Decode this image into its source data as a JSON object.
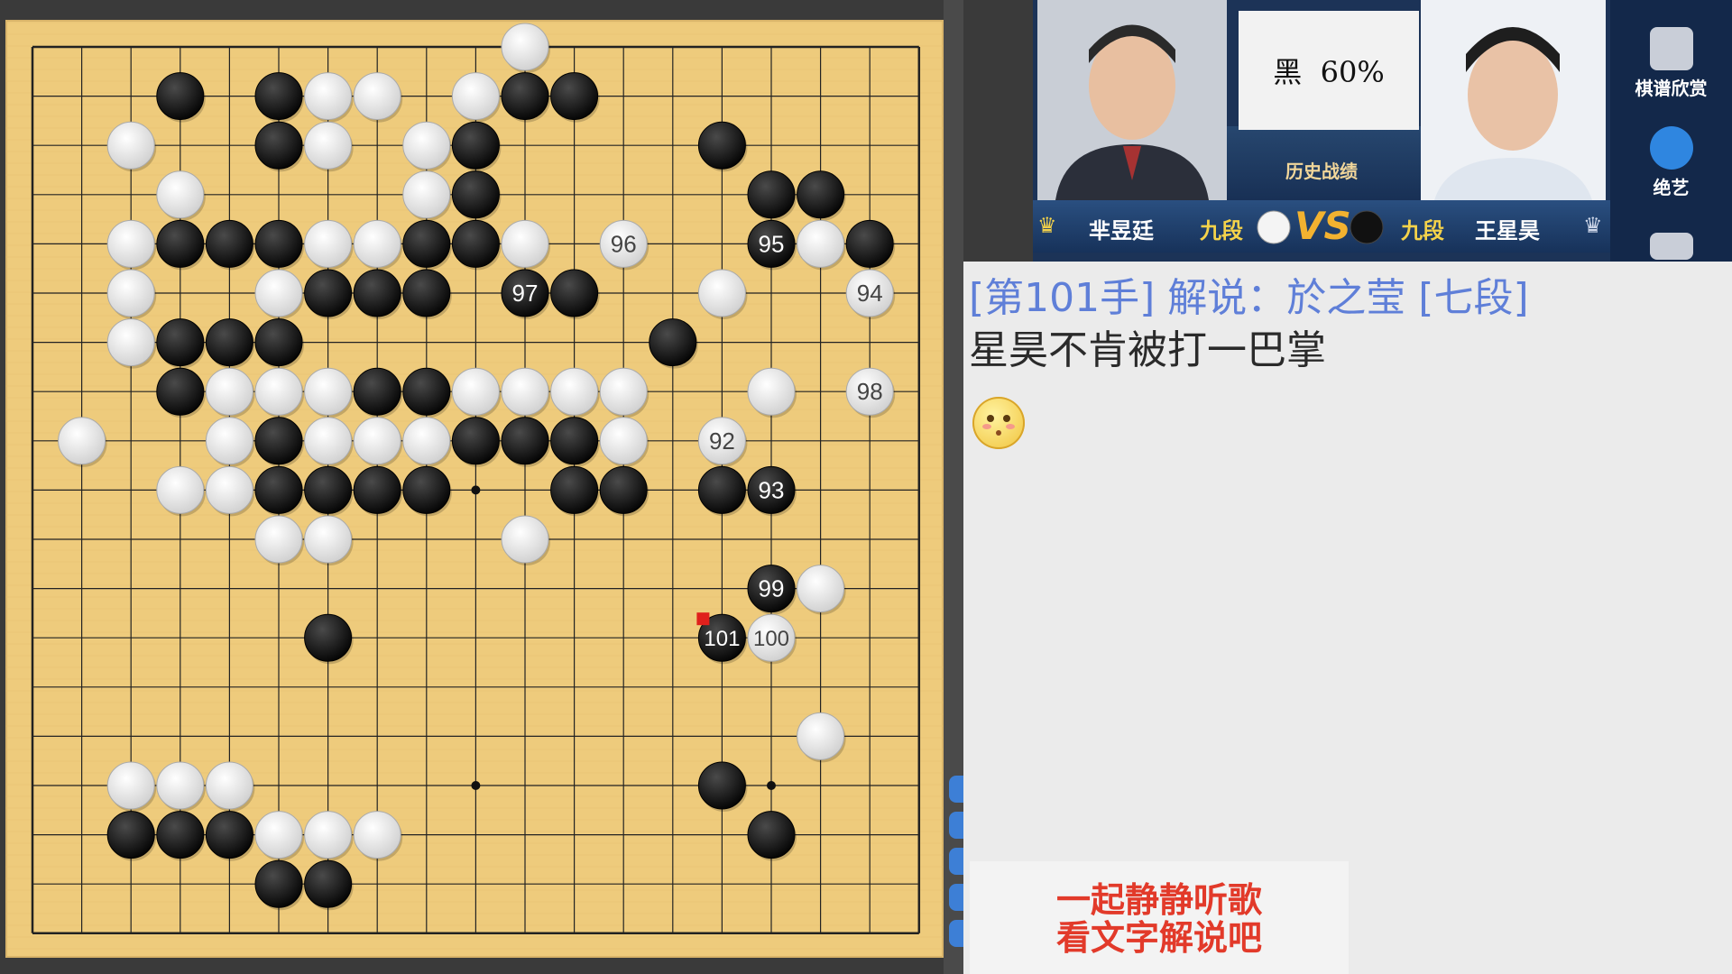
{
  "board": {
    "size": 19,
    "star_points": [
      [
        3,
        3
      ],
      [
        3,
        9
      ],
      [
        3,
        15
      ],
      [
        9,
        3
      ],
      [
        9,
        9
      ],
      [
        9,
        15
      ],
      [
        15,
        3
      ],
      [
        15,
        9
      ],
      [
        15,
        15
      ]
    ],
    "stones": [
      {
        "c": "w",
        "x": 10,
        "y": 0
      },
      {
        "c": "b",
        "x": 3,
        "y": 1
      },
      {
        "c": "b",
        "x": 5,
        "y": 1
      },
      {
        "c": "w",
        "x": 6,
        "y": 1
      },
      {
        "c": "w",
        "x": 7,
        "y": 1
      },
      {
        "c": "w",
        "x": 9,
        "y": 1
      },
      {
        "c": "b",
        "x": 10,
        "y": 1
      },
      {
        "c": "b",
        "x": 11,
        "y": 1
      },
      {
        "c": "w",
        "x": 2,
        "y": 2
      },
      {
        "c": "b",
        "x": 5,
        "y": 2
      },
      {
        "c": "w",
        "x": 6,
        "y": 2
      },
      {
        "c": "w",
        "x": 8,
        "y": 2
      },
      {
        "c": "b",
        "x": 9,
        "y": 2
      },
      {
        "c": "b",
        "x": 14,
        "y": 2
      },
      {
        "c": "w",
        "x": 3,
        "y": 3
      },
      {
        "c": "w",
        "x": 8,
        "y": 3
      },
      {
        "c": "b",
        "x": 9,
        "y": 3
      },
      {
        "c": "b",
        "x": 15,
        "y": 3
      },
      {
        "c": "b",
        "x": 16,
        "y": 3
      },
      {
        "c": "w",
        "x": 2,
        "y": 4
      },
      {
        "c": "b",
        "x": 3,
        "y": 4
      },
      {
        "c": "b",
        "x": 4,
        "y": 4
      },
      {
        "c": "b",
        "x": 5,
        "y": 4
      },
      {
        "c": "w",
        "x": 6,
        "y": 4
      },
      {
        "c": "w",
        "x": 7,
        "y": 4
      },
      {
        "c": "b",
        "x": 8,
        "y": 4
      },
      {
        "c": "b",
        "x": 9,
        "y": 4
      },
      {
        "c": "w",
        "x": 10,
        "y": 4
      },
      {
        "c": "w",
        "x": 12,
        "y": 4,
        "n": "96"
      },
      {
        "c": "b",
        "x": 15,
        "y": 4,
        "n": "95"
      },
      {
        "c": "w",
        "x": 16,
        "y": 4
      },
      {
        "c": "b",
        "x": 17,
        "y": 4
      },
      {
        "c": "w",
        "x": 2,
        "y": 5
      },
      {
        "c": "w",
        "x": 5,
        "y": 5
      },
      {
        "c": "b",
        "x": 6,
        "y": 5
      },
      {
        "c": "b",
        "x": 7,
        "y": 5
      },
      {
        "c": "b",
        "x": 8,
        "y": 5
      },
      {
        "c": "b",
        "x": 10,
        "y": 5,
        "n": "97"
      },
      {
        "c": "b",
        "x": 11,
        "y": 5
      },
      {
        "c": "w",
        "x": 14,
        "y": 5
      },
      {
        "c": "w",
        "x": 17,
        "y": 5,
        "n": "94"
      },
      {
        "c": "w",
        "x": 2,
        "y": 6
      },
      {
        "c": "b",
        "x": 3,
        "y": 6
      },
      {
        "c": "b",
        "x": 4,
        "y": 6
      },
      {
        "c": "b",
        "x": 5,
        "y": 6
      },
      {
        "c": "b",
        "x": 13,
        "y": 6
      },
      {
        "c": "b",
        "x": 3,
        "y": 7
      },
      {
        "c": "w",
        "x": 4,
        "y": 7
      },
      {
        "c": "w",
        "x": 5,
        "y": 7
      },
      {
        "c": "w",
        "x": 6,
        "y": 7
      },
      {
        "c": "b",
        "x": 7,
        "y": 7
      },
      {
        "c": "b",
        "x": 8,
        "y": 7
      },
      {
        "c": "w",
        "x": 9,
        "y": 7
      },
      {
        "c": "w",
        "x": 10,
        "y": 7
      },
      {
        "c": "w",
        "x": 11,
        "y": 7
      },
      {
        "c": "w",
        "x": 12,
        "y": 7
      },
      {
        "c": "w",
        "x": 15,
        "y": 7
      },
      {
        "c": "w",
        "x": 17,
        "y": 7,
        "n": "98"
      },
      {
        "c": "w",
        "x": 1,
        "y": 8
      },
      {
        "c": "w",
        "x": 4,
        "y": 8
      },
      {
        "c": "b",
        "x": 5,
        "y": 8
      },
      {
        "c": "w",
        "x": 6,
        "y": 8
      },
      {
        "c": "w",
        "x": 7,
        "y": 8
      },
      {
        "c": "w",
        "x": 8,
        "y": 8
      },
      {
        "c": "b",
        "x": 9,
        "y": 8
      },
      {
        "c": "b",
        "x": 10,
        "y": 8
      },
      {
        "c": "b",
        "x": 11,
        "y": 8
      },
      {
        "c": "w",
        "x": 12,
        "y": 8
      },
      {
        "c": "w",
        "x": 14,
        "y": 8,
        "n": "92"
      },
      {
        "c": "w",
        "x": 3,
        "y": 9
      },
      {
        "c": "w",
        "x": 4,
        "y": 9
      },
      {
        "c": "b",
        "x": 5,
        "y": 9
      },
      {
        "c": "b",
        "x": 6,
        "y": 9
      },
      {
        "c": "b",
        "x": 7,
        "y": 9
      },
      {
        "c": "b",
        "x": 8,
        "y": 9
      },
      {
        "c": "b",
        "x": 11,
        "y": 9
      },
      {
        "c": "b",
        "x": 12,
        "y": 9
      },
      {
        "c": "b",
        "x": 14,
        "y": 9
      },
      {
        "c": "b",
        "x": 15,
        "y": 9,
        "n": "93"
      },
      {
        "c": "w",
        "x": 5,
        "y": 10
      },
      {
        "c": "w",
        "x": 6,
        "y": 10
      },
      {
        "c": "w",
        "x": 10,
        "y": 10
      },
      {
        "c": "b",
        "x": 15,
        "y": 11,
        "n": "99"
      },
      {
        "c": "w",
        "x": 16,
        "y": 11
      },
      {
        "c": "b",
        "x": 6,
        "y": 12
      },
      {
        "c": "b",
        "x": 14,
        "y": 12,
        "n": "101",
        "last": true
      },
      {
        "c": "w",
        "x": 15,
        "y": 12,
        "n": "100"
      },
      {
        "c": "w",
        "x": 16,
        "y": 14
      },
      {
        "c": "w",
        "x": 2,
        "y": 15
      },
      {
        "c": "w",
        "x": 3,
        "y": 15
      },
      {
        "c": "w",
        "x": 4,
        "y": 15
      },
      {
        "c": "b",
        "x": 14,
        "y": 15
      },
      {
        "c": "b",
        "x": 2,
        "y": 16
      },
      {
        "c": "b",
        "x": 3,
        "y": 16
      },
      {
        "c": "b",
        "x": 4,
        "y": 16
      },
      {
        "c": "w",
        "x": 5,
        "y": 16
      },
      {
        "c": "w",
        "x": 6,
        "y": 16
      },
      {
        "c": "w",
        "x": 7,
        "y": 16
      },
      {
        "c": "b",
        "x": 15,
        "y": 16
      },
      {
        "c": "b",
        "x": 5,
        "y": 17
      },
      {
        "c": "b",
        "x": 6,
        "y": 17
      }
    ]
  },
  "players": {
    "left_name": "芈昱廷",
    "left_rank": "九段",
    "right_name": "王星昊",
    "right_rank": "九段",
    "vs": "VS",
    "history_label": "历史战绩",
    "winrate": "黑  60%"
  },
  "side_icons": {
    "record_label": "棋谱欣赏",
    "ai_label": "绝艺"
  },
  "commentary": {
    "header": "[第101手] 解说：於之莹 [七段]",
    "body": "星昊不肯被打一巴掌"
  },
  "overlay": {
    "line1": "一起静静听歌",
    "line2": "看文字解说吧"
  },
  "colors": {
    "board": "#eecb7c",
    "comment_header": "#5f7fd8",
    "overlay_text": "#e23a2a",
    "rank": "#f5d34a"
  }
}
